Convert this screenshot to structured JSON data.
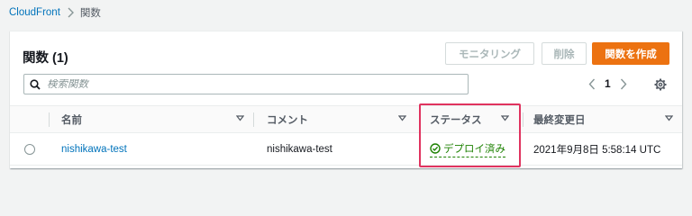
{
  "breadcrumb": {
    "root": "CloudFront",
    "current": "関数"
  },
  "panel": {
    "title": "関数 (1)",
    "buttons": {
      "monitoring": "モニタリング",
      "delete": "削除",
      "create": "関数を作成"
    }
  },
  "search": {
    "placeholder": "検索関数",
    "value": ""
  },
  "pagination": {
    "current_page": "1"
  },
  "table": {
    "columns": {
      "name": "名前",
      "comment": "コメント",
      "status": "ステータス",
      "last_modified": "最終変更日"
    },
    "rows": [
      {
        "name": "nishikawa-test",
        "comment": "nishikawa-test",
        "status": "デプロイ済み",
        "last_modified": "2021年9月8日 5:58:14 UTC"
      }
    ]
  },
  "colors": {
    "primary": "#ec7211",
    "link": "#0073bb",
    "success": "#1d8102",
    "highlight": "#e0335f"
  }
}
